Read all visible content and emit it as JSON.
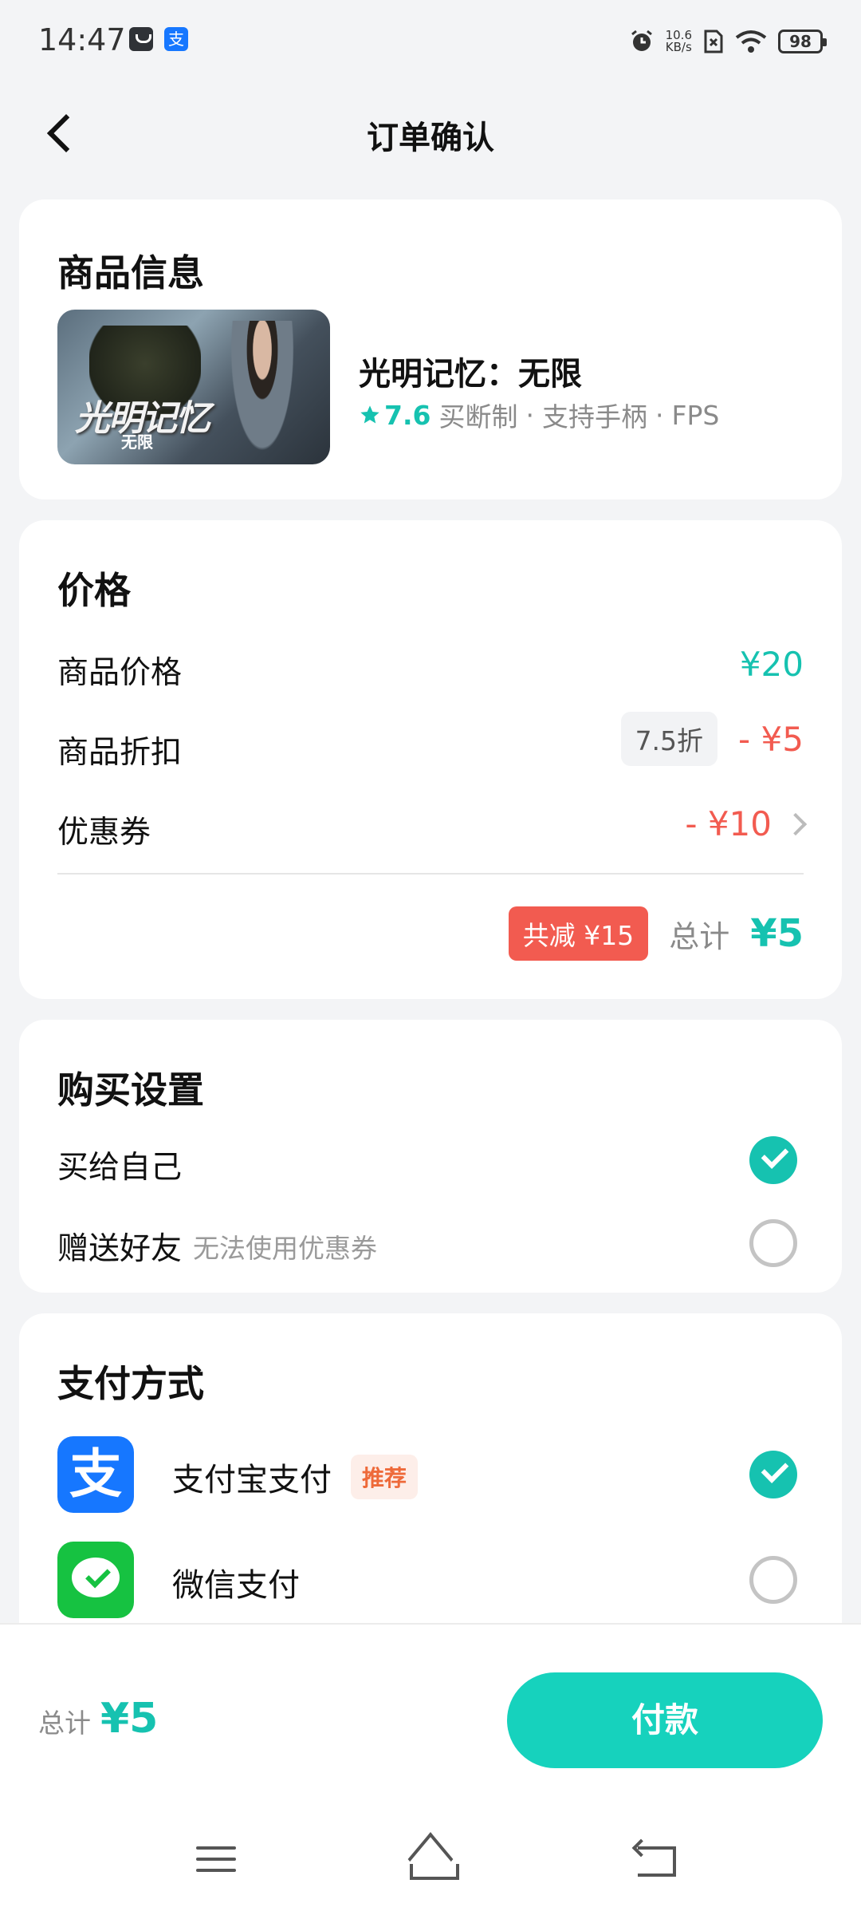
{
  "status_bar": {
    "time": "14:47",
    "speed_value": "10.6",
    "speed_unit": "KB/s",
    "battery": "98",
    "alipay_glyph": "支"
  },
  "header": {
    "title": "订单确认"
  },
  "product": {
    "section_title": "商品信息",
    "name": "光明记忆：无限",
    "thumb_title": "光明记忆",
    "thumb_sub": "无限",
    "rating": "7.6",
    "tags": [
      "买断制",
      "·",
      "支持手柄",
      "·",
      "FPS"
    ]
  },
  "price": {
    "section_title": "价格",
    "item_price_label": "商品价格",
    "item_price_value": "¥20",
    "discount_label": "商品折扣",
    "discount_tag": "7.5折",
    "discount_value": "- ¥5",
    "coupon_label": "优惠券",
    "coupon_value": "- ¥10",
    "saved_badge": "共减 ¥15",
    "total_label": "总计",
    "total_value": "¥5"
  },
  "purchase": {
    "section_title": "购买设置",
    "self_label": "买给自己",
    "gift_label": "赠送好友",
    "gift_hint": "无法使用优惠券"
  },
  "payment": {
    "section_title": "支付方式",
    "alipay_label": "支付宝支付",
    "alipay_icon_glyph": "支",
    "recommend_badge": "推荐",
    "wechat_label": "微信支付"
  },
  "bottom": {
    "total_label": "总计",
    "total_value": "¥5",
    "pay_button": "付款"
  },
  "icons": [
    "alarm-icon",
    "wifi-icon",
    "back-arrow-icon",
    "star-icon",
    "chevron-right-icon",
    "check-icon",
    "menu-icon",
    "home-icon",
    "return-icon"
  ],
  "colors": {
    "accent": "#16c2b0",
    "red": "#f25b50",
    "alipay": "#1677ff",
    "wechat": "#16c241"
  }
}
